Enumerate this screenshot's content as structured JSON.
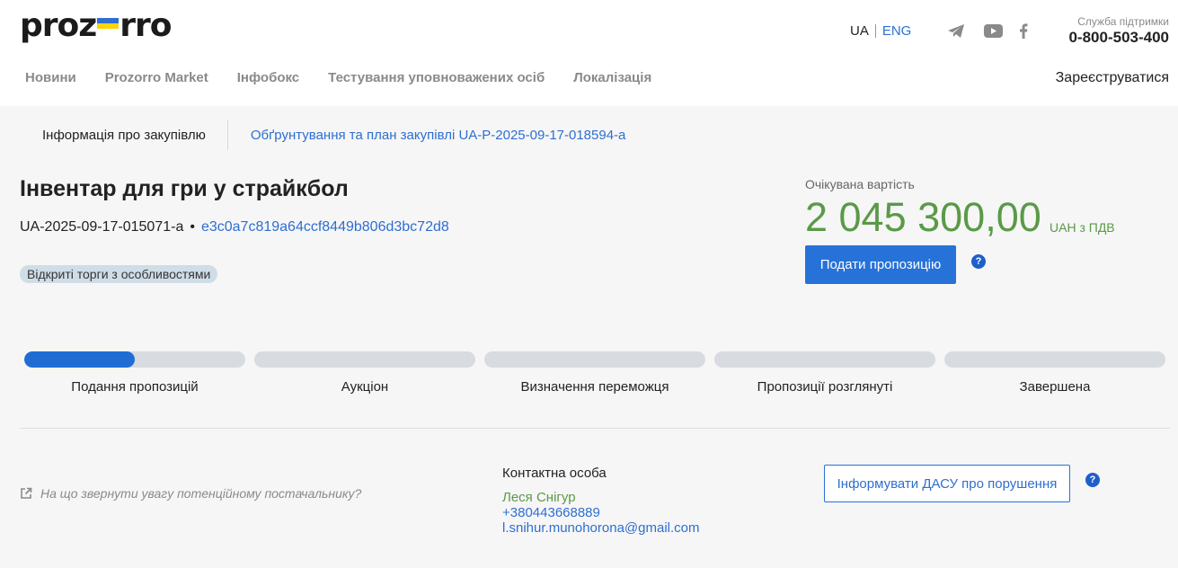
{
  "header": {
    "logo_text_left": "proz",
    "logo_text_right": "rro",
    "lang_ua": "UA",
    "lang_eng": "ENG",
    "support_label": "Служба підтримки",
    "support_phone": "0-800-503-400",
    "register_label": "Зареєструватися"
  },
  "nav": {
    "items": [
      "Новини",
      "Prozorro Market",
      "Інфобокс",
      "Тестування уповноважених осіб",
      "Локалізація"
    ]
  },
  "tabs": {
    "info": "Інформація про закупівлю",
    "plan": "Обґрунтування та план закупівлі UA-P-2025-09-17-018594-a"
  },
  "tender": {
    "title": "Інвентар для гри у страйкбол",
    "id": "UA-2025-09-17-015071-a",
    "separator": "•",
    "hash": "e3c0a7c819a64ccf8449b806d3bc72d8",
    "badge": "Відкриті торги з особливостями"
  },
  "value": {
    "label": "Очікувана вартість",
    "amount": "2 045 300,00",
    "currency": "UAH з ПДВ",
    "submit_label": "Подати пропозицію",
    "help": "?"
  },
  "stages": [
    {
      "label": "Подання пропозицій",
      "progress": 0.5
    },
    {
      "label": "Аукціон",
      "progress": 0
    },
    {
      "label": "Визначення переможця",
      "progress": 0
    },
    {
      "label": "Пропозиції розглянуті",
      "progress": 0
    },
    {
      "label": "Завершена",
      "progress": 0
    }
  ],
  "footer": {
    "hint": "На що звернути увагу потенційному постачальнику?",
    "contact_heading": "Контактна особа",
    "contact_name": "Леся Снігур",
    "contact_phone": "+380443668889",
    "contact_email": "l.snihur.munohorona@gmail.com",
    "dasu_label": "Інформувати ДАСУ про порушення",
    "help": "?"
  },
  "colors": {
    "accent": "#2672d8",
    "amount_green": "#5a9a47",
    "progress_fill": "#1f6dd3",
    "progress_track": "#d8dbe0"
  }
}
